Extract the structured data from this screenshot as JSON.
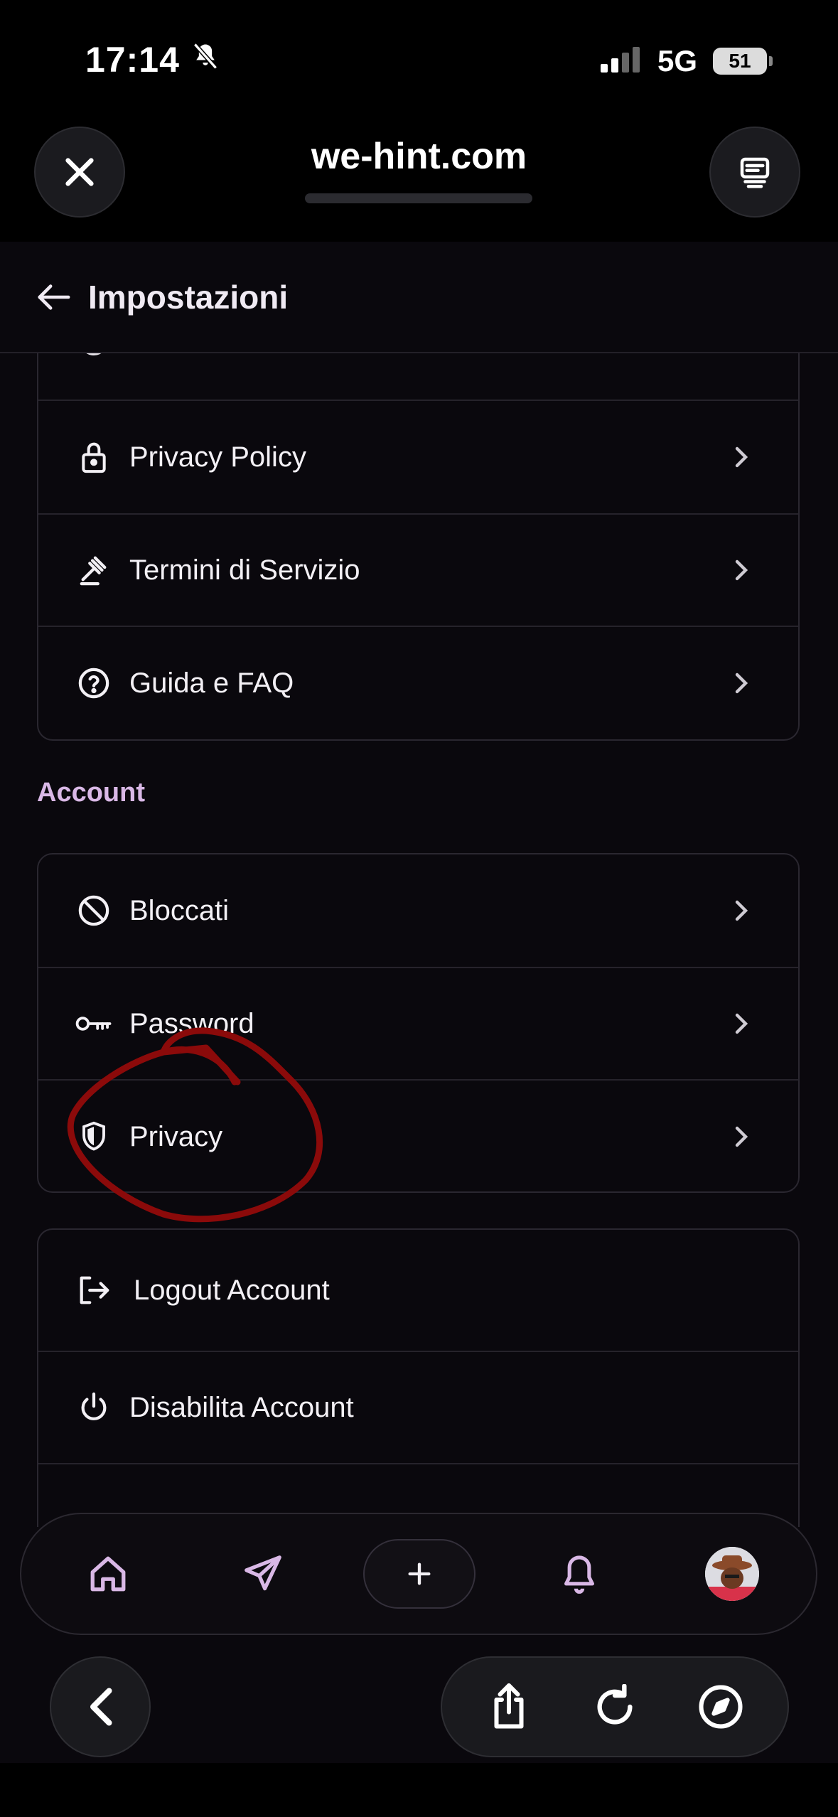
{
  "status_bar": {
    "time": "17:14",
    "network": "5G",
    "battery": "51"
  },
  "browser": {
    "url": "we-hint.com"
  },
  "header": {
    "title": "Impostazioni"
  },
  "info_section": {
    "items": [
      {
        "label": "Privacy Policy",
        "icon": "lock-icon"
      },
      {
        "label": "Termini di Servizio",
        "icon": "gavel-icon"
      },
      {
        "label": "Guida e FAQ",
        "icon": "help-circle-icon"
      }
    ]
  },
  "account_section": {
    "title": "Account",
    "items": [
      {
        "label": "Bloccati",
        "icon": "block-icon"
      },
      {
        "label": "Password",
        "icon": "key-icon"
      },
      {
        "label": "Privacy",
        "icon": "shield-icon"
      }
    ]
  },
  "danger_section": {
    "items": [
      {
        "label": "Logout Account",
        "icon": "logout-icon"
      },
      {
        "label": "Disabilita Account",
        "icon": "power-icon"
      }
    ]
  },
  "tab_bar": {
    "items": [
      "home-icon",
      "send-icon",
      "plus-icon",
      "bell-icon",
      "avatar"
    ]
  },
  "colors": {
    "background": "#0a080d",
    "accent": "#d9b8e6",
    "annotation": "#8b0a0a"
  }
}
